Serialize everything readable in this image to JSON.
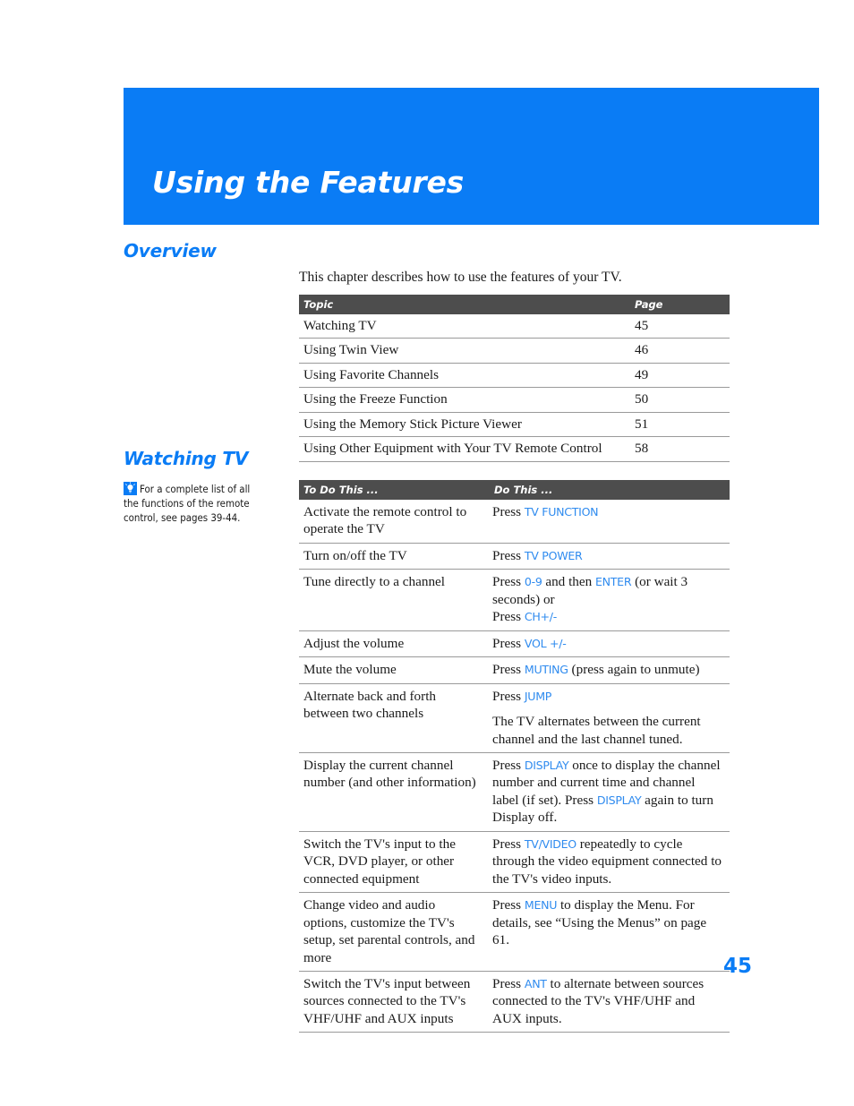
{
  "chapter": {
    "title": "Using the Features"
  },
  "sections": {
    "overview": {
      "heading": "Overview",
      "intro": "This chapter describes how to use the features of your TV."
    },
    "watching": {
      "heading": "Watching TV"
    }
  },
  "tip_note": {
    "icon": "lightbulb-tip-icon",
    "text": "For a complete list of all the functions of the remote control, see pages 39-44."
  },
  "overview_table": {
    "headers": [
      "Topic",
      "Page"
    ],
    "rows": [
      {
        "topic": "Watching TV",
        "page": "45"
      },
      {
        "topic": "Using Twin View",
        "page": "46"
      },
      {
        "topic": "Using Favorite Channels",
        "page": "49"
      },
      {
        "topic": "Using the Freeze Function",
        "page": "50"
      },
      {
        "topic": "Using the Memory Stick Picture Viewer",
        "page": "51"
      },
      {
        "topic": "Using Other Equipment with Your TV Remote Control",
        "page": "58"
      }
    ]
  },
  "watching_table": {
    "headers": [
      "To Do This ...",
      "Do This ..."
    ],
    "rows": [
      {
        "todo": "Activate the remote control to operate the TV",
        "do_parts": [
          {
            "t": "Press ",
            "k": false
          },
          {
            "t": "TV FUNCTION",
            "k": true
          }
        ]
      },
      {
        "todo": "Turn on/off the TV",
        "do_parts": [
          {
            "t": "Press ",
            "k": false
          },
          {
            "t": "TV POWER",
            "k": true
          }
        ]
      },
      {
        "todo": "Tune directly to a channel",
        "do_parts": [
          {
            "t": "Press ",
            "k": false
          },
          {
            "t": "0-9",
            "k": true
          },
          {
            "t": " and then ",
            "k": false
          },
          {
            "t": "ENTER",
            "k": true
          },
          {
            "t": " (or wait 3 seconds) or",
            "k": false
          },
          {
            "t": "\n",
            "k": false
          },
          {
            "t": "Press ",
            "k": false
          },
          {
            "t": "CH+/-",
            "k": true
          }
        ]
      },
      {
        "todo": "Adjust the volume",
        "do_parts": [
          {
            "t": "Press ",
            "k": false
          },
          {
            "t": "VOL +/-",
            "k": true
          }
        ]
      },
      {
        "todo": "Mute the volume",
        "do_parts": [
          {
            "t": "Press ",
            "k": false
          },
          {
            "t": "MUTING",
            "k": true
          },
          {
            "t": " (press again to unmute)",
            "k": false
          }
        ]
      },
      {
        "todo": "Alternate back and forth between two channels",
        "do_parts": [
          {
            "t": "Press ",
            "k": false
          },
          {
            "t": "JUMP",
            "k": true
          },
          {
            "t": "\n\n",
            "k": false
          },
          {
            "t": "The TV alternates between the current channel and the last channel tuned.",
            "k": false
          }
        ]
      },
      {
        "todo": "Display the current channel number (and other information)",
        "do_parts": [
          {
            "t": "Press ",
            "k": false
          },
          {
            "t": "DISPLAY",
            "k": true
          },
          {
            "t": " once to display the channel number and current time and channel label (if set). Press ",
            "k": false
          },
          {
            "t": "DISPLAY",
            "k": true
          },
          {
            "t": " again to turn Display off.",
            "k": false
          }
        ]
      },
      {
        "todo": "Switch the TV's input to the VCR, DVD player, or other connected equipment",
        "do_parts": [
          {
            "t": "Press ",
            "k": false
          },
          {
            "t": "TV/VIDEO",
            "k": true
          },
          {
            "t": " repeatedly to cycle through the video equipment connected to the TV's video inputs.",
            "k": false
          }
        ]
      },
      {
        "todo": "Change video and audio options, customize the TV's setup, set parental controls, and more",
        "do_parts": [
          {
            "t": "Press ",
            "k": false
          },
          {
            "t": "MENU",
            "k": true
          },
          {
            "t": " to display the Menu. For details, see “Using the Menus” on page 61.",
            "k": false
          }
        ]
      },
      {
        "todo": "Switch the TV's input between sources connected to the TV's VHF/UHF and AUX inputs",
        "do_parts": [
          {
            "t": "Press ",
            "k": false
          },
          {
            "t": "ANT",
            "k": true
          },
          {
            "t": " to alternate between sources connected to the TV's VHF/UHF and AUX inputs.",
            "k": false
          }
        ]
      }
    ]
  },
  "footer": {
    "page_number": "45"
  },
  "colors": {
    "brand_blue": "#0a7cf5",
    "key_blue": "#2f8bef",
    "table_header_gray": "#4d4d4d",
    "rule_gray": "#9a9a9a",
    "body_text": "#1a1a1a"
  }
}
